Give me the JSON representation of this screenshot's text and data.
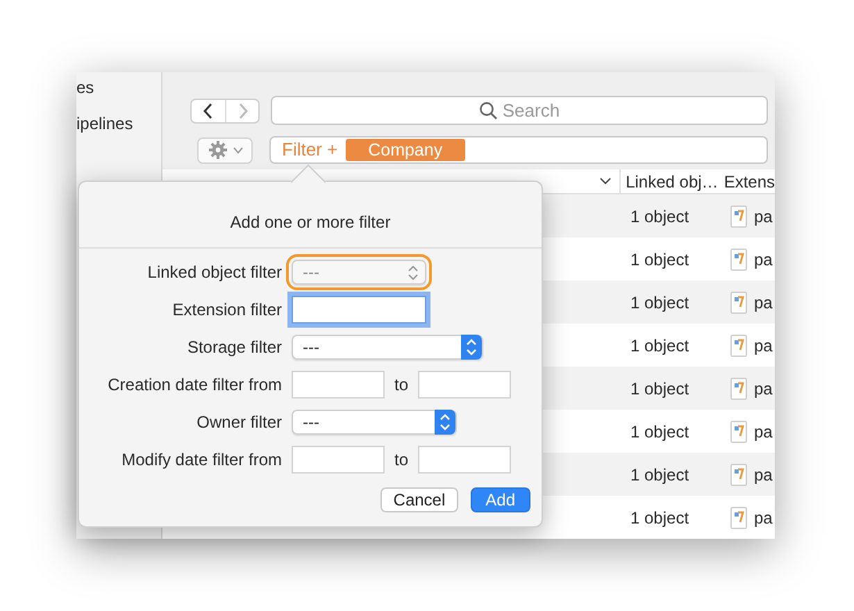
{
  "sidebar": {
    "items": [
      {
        "label": "es"
      },
      {
        "label": "ipelines"
      }
    ]
  },
  "toolbar": {
    "search": {
      "placeholder": "Search"
    },
    "filter": {
      "prefix": "Filter +",
      "tags": [
        {
          "label": "Company"
        }
      ]
    }
  },
  "table": {
    "columns": [
      {
        "label": "Linked obj…"
      },
      {
        "label": "Extens"
      }
    ],
    "rows": [
      {
        "linked": "1 object",
        "extension": "pa"
      },
      {
        "linked": "1 object",
        "extension": "pa"
      },
      {
        "linked": "1 object",
        "extension": "pa"
      },
      {
        "linked": "1 object",
        "extension": "pa"
      },
      {
        "linked": "1 object",
        "extension": "pa"
      },
      {
        "linked": "1 object",
        "extension": "pa"
      },
      {
        "linked": "1 object",
        "extension": "pa"
      },
      {
        "linked": "1 object",
        "extension": "pa"
      }
    ]
  },
  "popover": {
    "title": "Add one or more filter",
    "fields": [
      {
        "kind": "select",
        "label": "Linked object filter",
        "value": "---",
        "disabled": true,
        "highlighted": true
      },
      {
        "kind": "text",
        "label": "Extension filter",
        "focused": true
      },
      {
        "kind": "select",
        "label": "Storage filter",
        "value": "---"
      },
      {
        "kind": "date_range",
        "label": "Creation date filter from",
        "separator": "to"
      },
      {
        "kind": "select",
        "label": "Owner filter",
        "value": "---"
      },
      {
        "kind": "date_range",
        "label": "Modify date filter from",
        "separator": "to"
      }
    ],
    "buttons": [
      {
        "label": "Cancel",
        "primary": false
      },
      {
        "label": "Add",
        "primary": true
      }
    ]
  }
}
